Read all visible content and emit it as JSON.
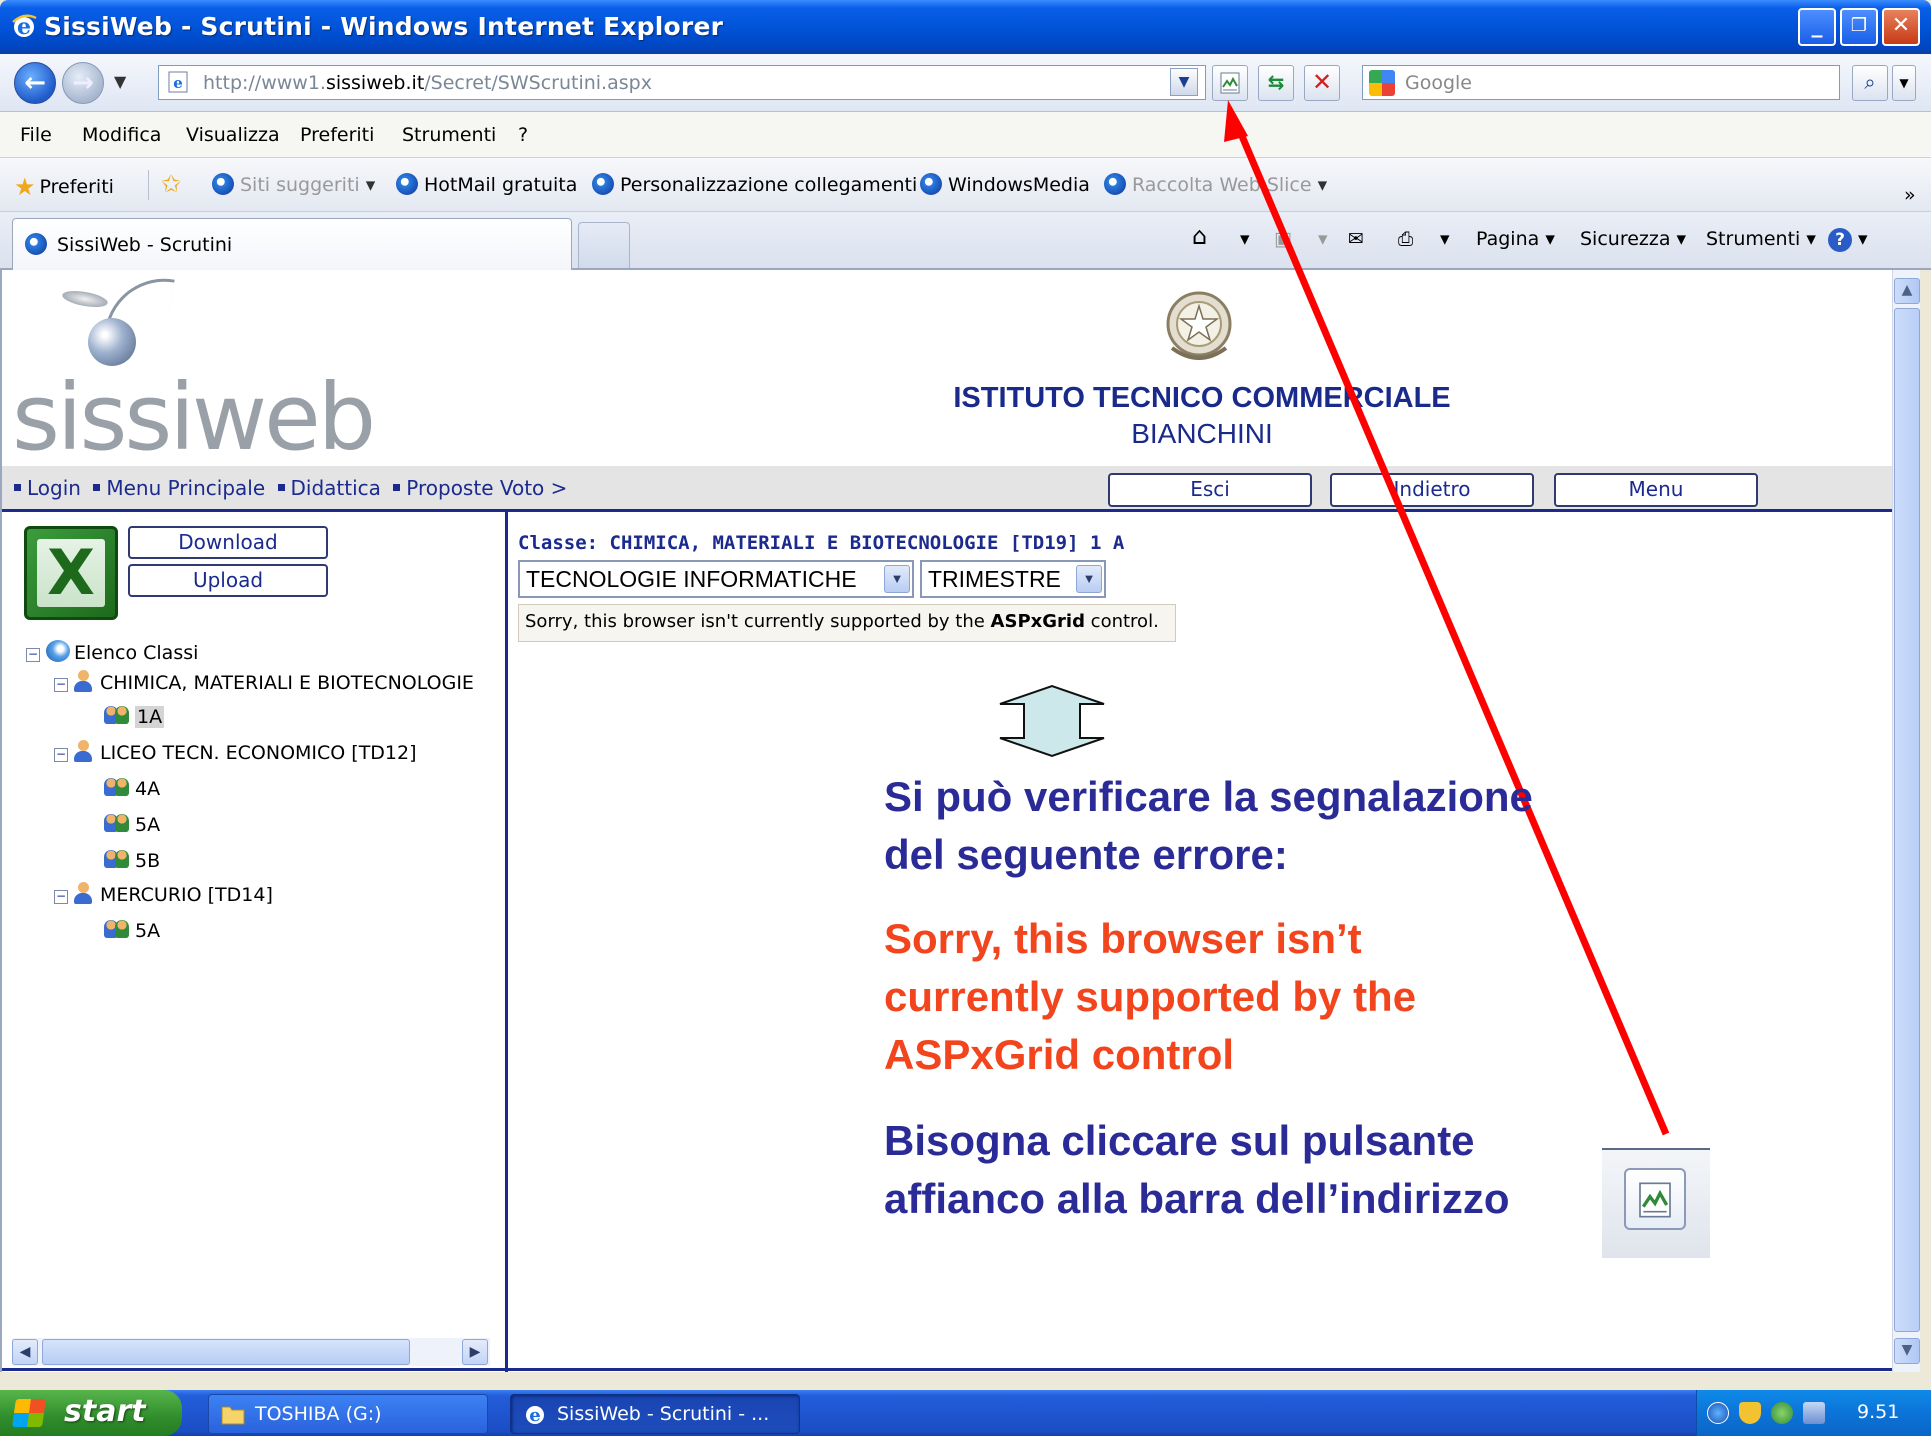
{
  "window": {
    "title": "SissiWeb - Scrutini - Windows Internet Explorer",
    "minimize": "_",
    "maximize": "❐",
    "close": "✕"
  },
  "address": {
    "url_prefix": "http://www1.",
    "url_domain": "sissiweb.it",
    "url_path": "/Secret/SWScrutini.aspx",
    "search_placeholder": "Google"
  },
  "menu": [
    "File",
    "Modifica",
    "Visualizza",
    "Preferiti",
    "Strumenti",
    "?"
  ],
  "favorites": {
    "preferiti": "Preferiti",
    "links": [
      {
        "label": "Siti suggeriti",
        "dim": true
      },
      {
        "label": "HotMail gratuita"
      },
      {
        "label": "Personalizzazione collegamenti"
      },
      {
        "label": "WindowsMedia"
      },
      {
        "label": "Raccolta Web Slice",
        "dim": true
      }
    ],
    "overflow": "»"
  },
  "tab": {
    "label": "SissiWeb - Scrutini"
  },
  "commandbar": {
    "pagina": "Pagina",
    "sicurezza": "Sicurezza",
    "strumenti": "Strumenti"
  },
  "page": {
    "logo": "sissiweb",
    "school_name": "ISTITUTO TECNICO COMMERCIALE",
    "school_sub": "BIANCHINI",
    "breadcrumb": [
      "Login",
      "Menu Principale",
      "Didattica",
      "Proposte Voto >"
    ],
    "buttons": {
      "esci": "Esci",
      "indietro": "Indietro",
      "menu": "Menu"
    },
    "download": "Download",
    "upload": "Upload",
    "tree": {
      "root": "Elenco Classi",
      "groups": [
        {
          "label": "CHIMICA, MATERIALI E BIOTECNOLOGIE",
          "classes": [
            "1A"
          ]
        },
        {
          "label": "LICEO TECN. ECONOMICO [TD12]",
          "classes": [
            "4A",
            "5A",
            "5B"
          ]
        },
        {
          "label": "MERCURIO [TD14]",
          "classes": [
            "5A"
          ]
        }
      ]
    },
    "class_title": "Classe: CHIMICA, MATERIALI E BIOTECNOLOGIE [TD19] 1 A",
    "subject_select": "TECNOLOGIE INFORMATICHE",
    "period_select": "TRIMESTRE",
    "error_prefix": "Sorry, this browser isn't currently supported by the ",
    "error_bold": "ASPxGrid",
    "error_suffix": " control."
  },
  "annotations": {
    "line1": "Si può verificare la segnalazione",
    "line2": "del seguente errore:",
    "line3": "Sorry, this browser isn’t",
    "line4": "currently supported by the",
    "line5": "ASPxGrid control",
    "line6": "Bisogna cliccare sul pulsante",
    "line7": "affianco alla barra dell’indirizzo"
  },
  "taskbar": {
    "start": "start",
    "task1": "TOSHIBA (G:)",
    "task2": "SissiWeb - Scrutini - ...",
    "clock": "9.51"
  },
  "colors": {
    "title_blue": "#0052d6",
    "page_navy": "#1c2a8e",
    "annotation_blue": "#2a2b96",
    "annotation_red": "#f2451d",
    "arrow_red": "#ff0000"
  }
}
